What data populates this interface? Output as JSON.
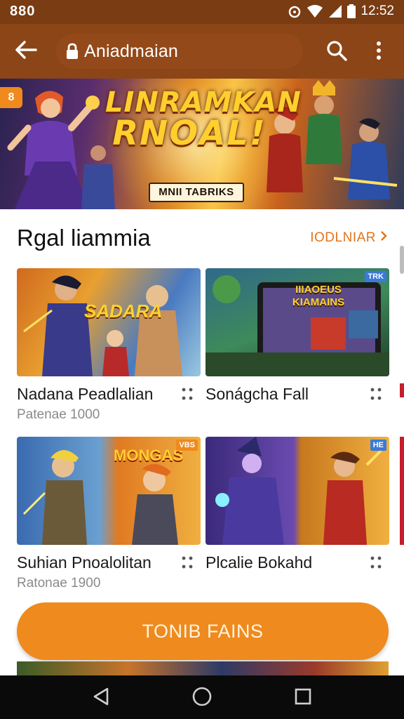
{
  "status_bar": {
    "left_text": "880",
    "time": "12:52"
  },
  "app_bar": {
    "url_text": "Aniadmaian",
    "icons": [
      "back-arrow-icon",
      "lock-icon",
      "search-icon",
      "more-vert-icon"
    ]
  },
  "hero": {
    "badge": "8",
    "title_line1": "LINRAMKAN",
    "title_line2": "RNOAL!",
    "tag": "MNII TABRIKS"
  },
  "section": {
    "title": "Rgal liammia",
    "see_all": "IODLNIAR"
  },
  "cards": [
    {
      "title": "Nadana Peadlalian",
      "subtitle": "Patenae 1000",
      "image_text": "SADARA",
      "corner": ""
    },
    {
      "title": "Sonágcha Fall",
      "subtitle": "",
      "image_text": "IIIAOEUS KIAMAINS",
      "corner": "TRK"
    },
    {
      "title": "Suhian Pnoalolitan",
      "subtitle": "Ratonae 1900",
      "image_text": "MONGAS",
      "corner": "VBS"
    },
    {
      "title": "Plcalie Bokahd",
      "subtitle": "",
      "image_text": "",
      "corner": "HE"
    }
  ],
  "cta": {
    "label": "TONIB FAINS"
  },
  "nav": {
    "icons": [
      "nav-back-icon",
      "nav-home-icon",
      "nav-recents-icon"
    ]
  },
  "colors": {
    "status": "#7a3c12",
    "app_bar": "#8c4516",
    "accent": "#ef8a1e",
    "link": "#e2751c"
  }
}
